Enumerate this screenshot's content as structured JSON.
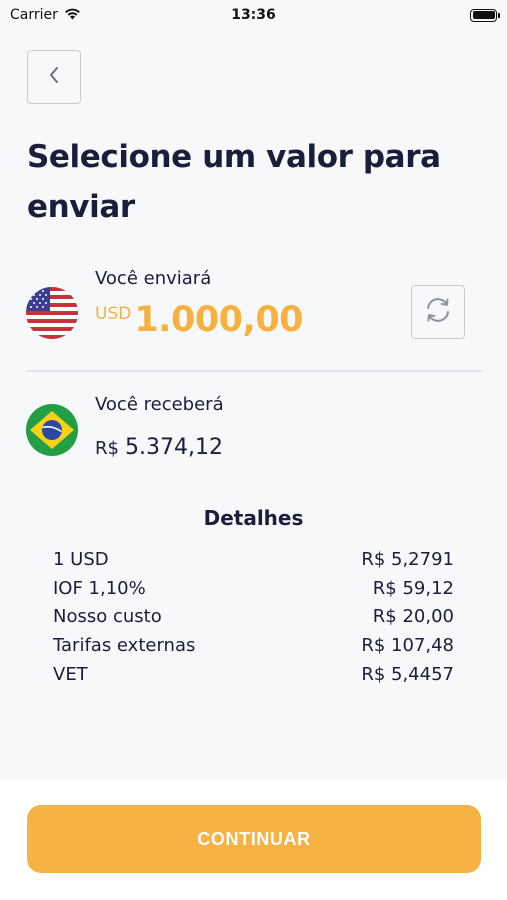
{
  "status_bar": {
    "carrier": "Carrier",
    "time": "13:36"
  },
  "header": {
    "title": "Selecione um valor para enviar"
  },
  "send": {
    "label": "Você enviará",
    "currency": "USD",
    "amount": "1.000,00",
    "flag_icon": "usa-flag-icon"
  },
  "receive": {
    "label": "Você receberá",
    "currency": "R$",
    "amount": "5.374,12",
    "flag_icon": "brazil-flag-icon"
  },
  "details": {
    "title": "Detalhes",
    "rows": [
      {
        "label": "1 USD",
        "value": "R$ 5,2791"
      },
      {
        "label": "IOF 1,10%",
        "value": "R$ 59,12"
      },
      {
        "label": "Nosso custo",
        "value": "R$ 20,00"
      },
      {
        "label": "Tarifas externas",
        "value": "R$ 107,48"
      },
      {
        "label": "VET",
        "value": "R$ 5,4457"
      }
    ]
  },
  "footer": {
    "continue_label": "CONTINUAR"
  },
  "colors": {
    "accent": "#f7b244",
    "amount_orange": "#f6b13f",
    "text_dark": "#1c1d3a"
  }
}
